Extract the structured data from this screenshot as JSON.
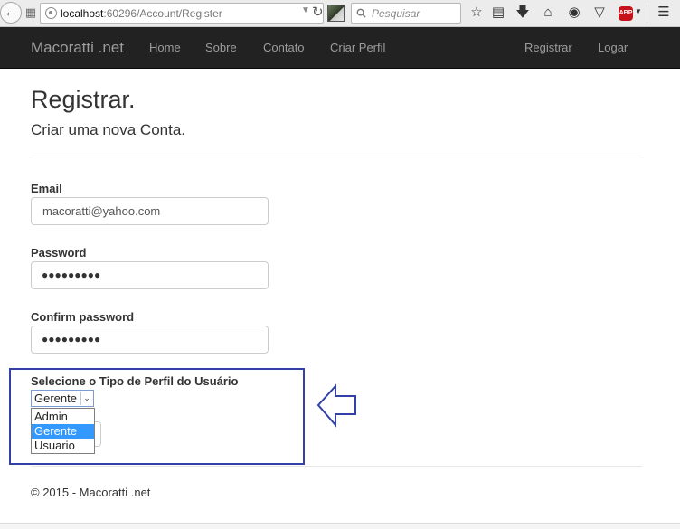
{
  "browser": {
    "url_host": "localhost",
    "url_path": ":60296/Account/Register",
    "search_placeholder": "Pesquisar",
    "adblock_label": "ABP"
  },
  "navbar": {
    "brand": "Macoratti .net",
    "items": [
      "Home",
      "Sobre",
      "Contato",
      "Criar Perfil"
    ],
    "right_items": [
      "Registrar",
      "Logar"
    ]
  },
  "page": {
    "title": "Registrar.",
    "subtitle": "Criar uma nova Conta."
  },
  "form": {
    "email_label": "Email",
    "email_value": "macoratti@yahoo.com",
    "password_label": "Password",
    "password_value": "●●●●●●●●●",
    "confirm_label": "Confirm password",
    "confirm_value": "●●●●●●●●●",
    "profile_label": "Selecione o Tipo de Perfil do Usuário",
    "profile_selected": "Gerente",
    "profile_options": [
      "Admin",
      "Gerente",
      "Usuario"
    ]
  },
  "footer": {
    "text": "© 2015 - Macoratti .net"
  },
  "colors": {
    "navbar_bg": "#222222",
    "nav_text": "#9d9d9d",
    "highlight_border": "#3340a8",
    "option_selected": "#3399ff"
  }
}
